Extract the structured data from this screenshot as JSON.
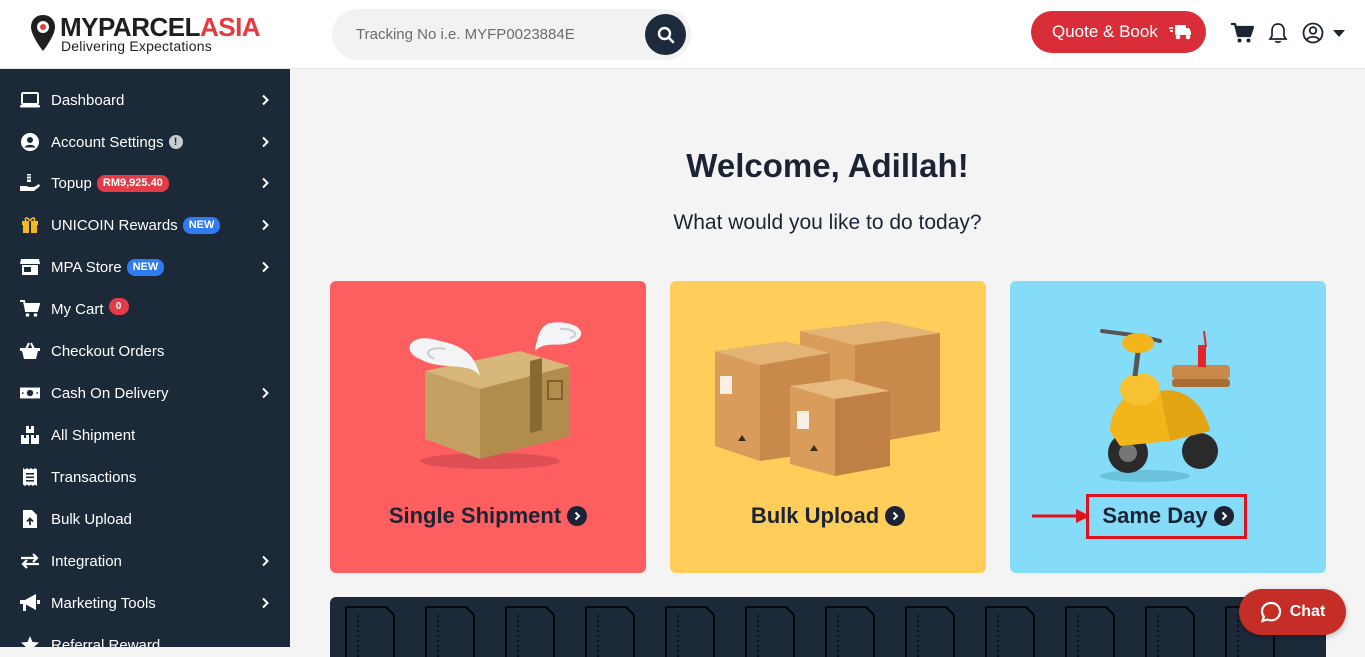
{
  "brand": {
    "name_part1": "MYPARCEL",
    "name_part2": "ASIA",
    "tagline": "Delivering Expectations"
  },
  "search": {
    "placeholder": "Tracking No i.e. MYFP0023884E"
  },
  "header": {
    "quote_label": "Quote & Book"
  },
  "sidebar": {
    "items": [
      {
        "label": "Dashboard",
        "icon": "laptop-icon"
      },
      {
        "label": "Account Settings",
        "icon": "user-circle-icon",
        "info": "!"
      },
      {
        "label": "Topup",
        "icon": "hand-coin-icon",
        "badge": "RM9,925.40"
      },
      {
        "label": "UNICOIN Rewards",
        "icon": "gift-icon",
        "badge": "NEW"
      },
      {
        "label": "MPA Store",
        "icon": "store-icon",
        "badge": "NEW"
      },
      {
        "label": "My Cart",
        "icon": "cart-icon",
        "badge": "0"
      },
      {
        "label": "Checkout Orders",
        "icon": "basket-icon"
      },
      {
        "label": "Cash On Delivery",
        "icon": "cash-icon"
      },
      {
        "label": "All Shipment",
        "icon": "boxes-icon"
      },
      {
        "label": "Transactions",
        "icon": "receipt-icon"
      },
      {
        "label": "Bulk Upload",
        "icon": "file-upload-icon"
      },
      {
        "label": "Integration",
        "icon": "arrows-exchange-icon"
      },
      {
        "label": "Marketing Tools",
        "icon": "megaphone-icon"
      },
      {
        "label": "Referral Reward",
        "icon": "star-icon"
      }
    ]
  },
  "main": {
    "welcome": "Welcome, Adillah!",
    "subtitle": "What would you like to do today?",
    "cards": [
      {
        "title": "Single Shipment",
        "color": "#fd5f61"
      },
      {
        "title": "Bulk Upload",
        "color": "#ffcd5a"
      },
      {
        "title": "Same Day",
        "color": "#84dcf8"
      }
    ]
  },
  "chat": {
    "label": "Chat"
  },
  "colors": {
    "sidebar": "#1c2939",
    "accent_red": "#d92d3a",
    "highlight": "#e0101c"
  }
}
